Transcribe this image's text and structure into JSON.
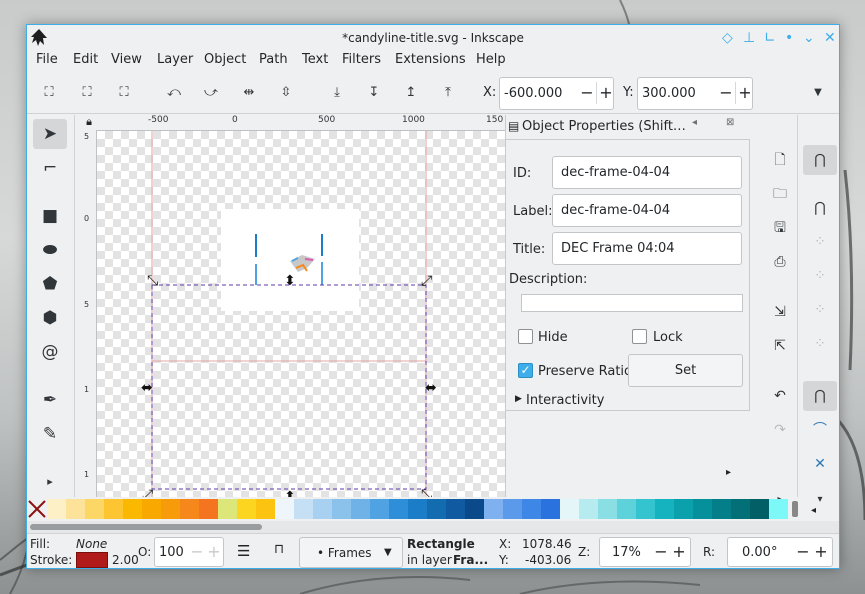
{
  "window": {
    "title": "*candyline-title.svg - Inkscape"
  },
  "menu": [
    "File",
    "Edit",
    "View",
    "Layer",
    "Object",
    "Path",
    "Text",
    "Filters",
    "Extensions",
    "Help"
  ],
  "controls": {
    "x_label": "X:",
    "x_value": "-600.000",
    "y_label": "Y:",
    "y_value": "300.000"
  },
  "ruler": {
    "top": [
      "-500",
      "0",
      "500",
      "1000",
      "150"
    ],
    "left": [
      "5",
      "0",
      "5",
      "1",
      "1"
    ]
  },
  "panel": {
    "title": "Object Properties (Shift…",
    "id_label": "ID:",
    "id_value": "dec-frame-04-04",
    "label_label": "Label:",
    "label_value": "dec-frame-04-04",
    "title_label": "Title:",
    "title_value": "DEC Frame 04:04",
    "description_label": "Description:",
    "hide_label": "Hide",
    "lock_label": "Lock",
    "preserve_ratio_label": "Preserve Ratio",
    "preserve_ratio_checked": true,
    "set_button": "Set",
    "interactivity_label": "Interactivity"
  },
  "palette_colors": [
    "#fdf0c6",
    "#fde39a",
    "#fdd766",
    "#fdc531",
    "#fbb800",
    "#f9a800",
    "#f89b0a",
    "#f6881b",
    "#f47420",
    "#dde779",
    "#fcd520",
    "#fcc410",
    "#eef5fb",
    "#c5e0f5",
    "#a8d1f1",
    "#8ac2ec",
    "#6eb2e7",
    "#4fa3e2",
    "#2e8fd8",
    "#1b7cc7",
    "#136bb0",
    "#0f5aa0",
    "#0a4a8a",
    "#7fb0ef",
    "#5b9aeb",
    "#3f87e6",
    "#2a73de",
    "#e4f6f8",
    "#b6ebef",
    "#8adfe5",
    "#5ed2da",
    "#33c4cf",
    "#14b3bf",
    "#0aa1ad",
    "#06909b",
    "#047e88",
    "#036f77",
    "#025f66",
    "#7df8f8"
  ],
  "status": {
    "fill_label": "Fill:",
    "fill_value": "None",
    "stroke_label": "Stroke:",
    "stroke_color": "#b11a1a",
    "stroke_width": "2.00",
    "opacity_label": "O:",
    "opacity_value": "100",
    "layer_value": "• Frames",
    "obj_type": "Rectangle",
    "obj_layer_prefix": "in layer ",
    "obj_layer_name": "Fra...",
    "x_label": "X:",
    "x_value": "1078.46",
    "y_label": "Y:",
    "y_value": "-403.06",
    "zoom_label": "Z:",
    "zoom_value": "17%",
    "rotation_label": "R:",
    "rotation_value": "0.00°"
  }
}
